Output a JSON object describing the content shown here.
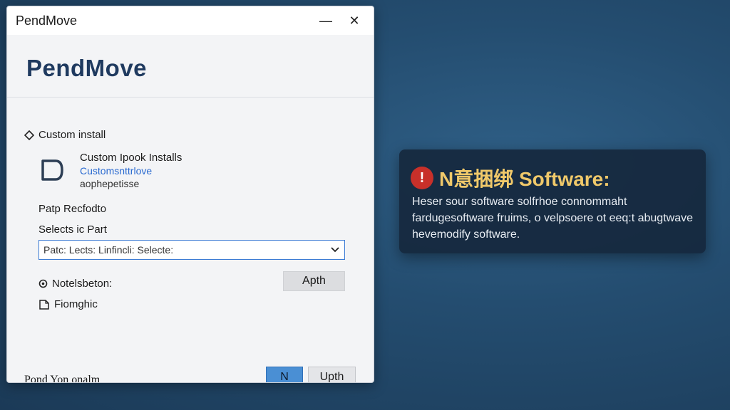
{
  "window": {
    "title": "PendMove",
    "minimize_label": "—",
    "close_label": "✕"
  },
  "brand": "PendMove",
  "install": {
    "radio_label": "Custom install",
    "option_title": "Custom Ipook Installs",
    "option_link": "Customsnttrlove",
    "option_desc": "aophepetisse"
  },
  "path_label": "Patp Recfodto",
  "selects_label": "Selects ic Part",
  "select": {
    "value": "Patc: Lects: Linfincli: Selecte:"
  },
  "note_label": "Notelsbeton:",
  "apply_button": "Apth",
  "graphic_label": "Fiomghic",
  "footer_link": "Pond Yon onalm",
  "primary_button": "N",
  "secondary_button": "Upth",
  "toast": {
    "title": "N意捆绑 Software:",
    "body": "Heser sour software solfrhoe connommaht fardugesoftware fruims, o velpsoere ot eeq:t abugtwave hevemodify software."
  },
  "colors": {
    "accent": "#4a8fd4",
    "brand": "#1f3a5f",
    "alert": "#c8302a",
    "toast_title": "#f0c96a"
  }
}
